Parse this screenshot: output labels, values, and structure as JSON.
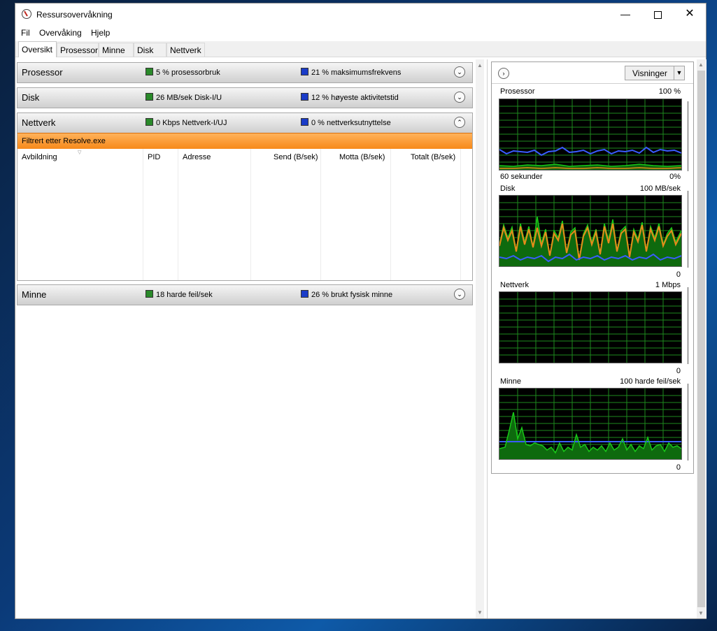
{
  "window": {
    "title": "Ressursovervåkning",
    "controls": {
      "minimize": "—",
      "maximize": "☐",
      "close": "✕"
    }
  },
  "menu": [
    "Fil",
    "Overvåking",
    "Hjelp"
  ],
  "tabs": [
    "Oversikt",
    "Prosessor",
    "Minne",
    "Disk",
    "Nettverk"
  ],
  "sections": {
    "processor": {
      "title": "Prosessor",
      "stat1": "5 % prosessorbruk",
      "stat2": "21 % maksimumsfrekvens"
    },
    "disk": {
      "title": "Disk",
      "stat1": "26 MB/sek Disk-I/U",
      "stat2": "12 % høyeste aktivitetstid"
    },
    "network": {
      "title": "Nettverk",
      "stat1": "0 Kbps Nettverk-I/UJ",
      "stat2": "0 % nettverksutnyttelse",
      "filter": "Filtrert etter Resolve.exe",
      "columns": [
        "Avbildning",
        "PID",
        "Adresse",
        "Send (B/sek)",
        "Motta (B/sek)",
        "Totalt (B/sek)"
      ]
    },
    "memory": {
      "title": "Minne",
      "stat1": "18 harde feil/sek",
      "stat2": "26 % brukt fysisk minne"
    }
  },
  "graphs": {
    "views_button": "Visninger",
    "processor": {
      "name": "Prosessor",
      "max": "100 %",
      "footer_left": "60 sekunder",
      "footer_right": "0%"
    },
    "disk": {
      "name": "Disk",
      "max": "100 MB/sek",
      "min": "0"
    },
    "network": {
      "name": "Nettverk",
      "max": "1 Mbps",
      "min": "0"
    },
    "memory": {
      "name": "Minne",
      "max": "100 harde feil/sek",
      "min": "0"
    }
  },
  "colors": {
    "graph_grid": "#1e8a1e",
    "series_green": "#18c818",
    "series_blue": "#3a5cff",
    "series_orange": "#e88a1a",
    "filter_bar": "#f7891a"
  }
}
